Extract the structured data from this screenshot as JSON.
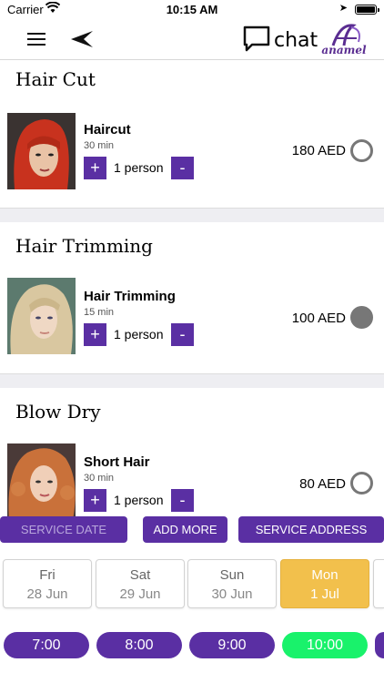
{
  "status_bar": {
    "carrier": "Carrier",
    "time": "10:15 AM",
    "battery_level": 1.0
  },
  "header": {
    "menu_icon": "hamburger-icon",
    "back_icon": "back-arrow-icon",
    "chat_label": "chat",
    "logo_text": "anamel"
  },
  "sections": [
    {
      "title": "Hair Cut",
      "service": {
        "name": "Haircut",
        "duration": "30 min",
        "persons": "1 person",
        "price": "180 AED",
        "selected": false,
        "image": "red-haired-woman-portrait"
      }
    },
    {
      "title": "Hair Trimming",
      "service": {
        "name": "Hair Trimming",
        "duration": "15 min",
        "persons": "1 person",
        "price": "100 AED",
        "selected": true,
        "image": "blonde-woman-portrait"
      }
    },
    {
      "title": "Blow Dry",
      "service": {
        "name": "Short Hair",
        "duration": "30 min",
        "persons": "1 person",
        "price": "80 AED",
        "selected": false,
        "image": "curly-redhead-portrait"
      }
    }
  ],
  "qty": {
    "plus": "+",
    "minus": "-"
  },
  "actions": {
    "service_date": "SERVICE DATE",
    "add_more": "ADD MORE",
    "service_address": "SERVICE ADDRESS"
  },
  "days": [
    {
      "day": "Fri",
      "date": "28 Jun",
      "selected": false
    },
    {
      "day": "Sat",
      "date": "29 Jun",
      "selected": false
    },
    {
      "day": "Sun",
      "date": "30 Jun",
      "selected": false
    },
    {
      "day": "Mon",
      "date": "1 Jul",
      "selected": true
    }
  ],
  "times": [
    {
      "label": "7:00",
      "selected": false
    },
    {
      "label": "8:00",
      "selected": false
    },
    {
      "label": "9:00",
      "selected": false
    },
    {
      "label": "10:00",
      "selected": true
    }
  ],
  "colors": {
    "brand_purple": "#5a2fa3",
    "selected_day": "#f2c04c",
    "selected_time": "#19f26b",
    "radio_gray": "#777777"
  }
}
